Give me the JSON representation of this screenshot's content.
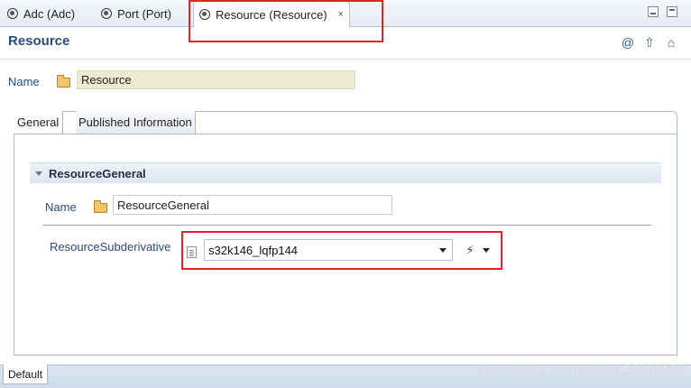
{
  "editor_tabs": [
    {
      "label": "Adc (Adc)",
      "active": false
    },
    {
      "label": "Port (Port)",
      "active": false
    },
    {
      "label": "Resource (Resource)",
      "active": true,
      "close_icon": "×"
    }
  ],
  "header": {
    "title": "Resource",
    "icons": [
      "at-icon",
      "up-arrow-icon",
      "home-icon"
    ],
    "icon_glyphs": {
      "at": "@",
      "up": "⇧",
      "home": "⌂"
    }
  },
  "name_field": {
    "label": "Name",
    "value": "Resource"
  },
  "panel_tabs": [
    {
      "label": "General",
      "active": true
    },
    {
      "label": "Published Information",
      "active": false
    }
  ],
  "section": {
    "title": "ResourceGeneral",
    "name_field": {
      "label": "Name",
      "value": "ResourceGeneral"
    },
    "subderivative": {
      "label": "ResourceSubderivative",
      "selected": "s32k146_lqfp144",
      "action_glyph": "⚡"
    }
  },
  "bottom_tabs": [
    {
      "label": "Default",
      "active": true
    }
  ],
  "watermark": "https://blog.csdn.net/qq_25920091",
  "colors": {
    "highlight_box": "#e02525",
    "title_text": "#2b4a7e",
    "name_input_bg": "#ecebd0"
  }
}
